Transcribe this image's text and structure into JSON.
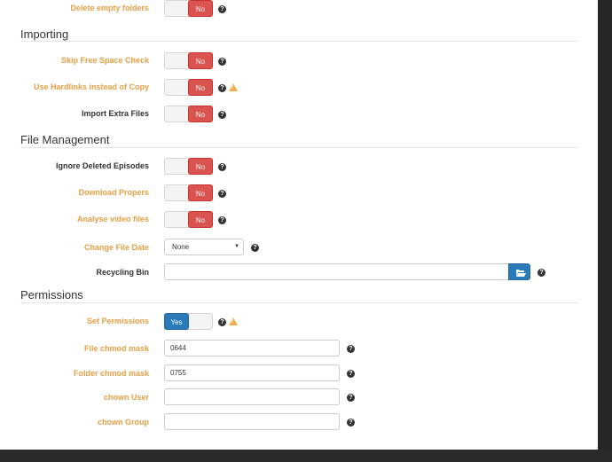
{
  "top_row": {
    "label": "Delete empty folders",
    "value": "No"
  },
  "sections": {
    "importing": "Importing",
    "file_management": "File Management",
    "permissions": "Permissions"
  },
  "importing": {
    "skip_free_space": {
      "label": "Skip Free Space Check",
      "value": "No"
    },
    "use_hardlinks": {
      "label": "Use Hardlinks instead of Copy",
      "value": "No"
    },
    "import_extra": {
      "label": "Import Extra Files",
      "value": "No"
    }
  },
  "file_management": {
    "ignore_deleted": {
      "label": "Ignore Deleted Episodes",
      "value": "No"
    },
    "download_propers": {
      "label": "Download Propers",
      "value": "No"
    },
    "analyse_video": {
      "label": "Analyse video files",
      "value": "No"
    },
    "change_file_date": {
      "label": "Change File Date",
      "value": "None"
    },
    "recycling_bin": {
      "label": "Recycling Bin",
      "value": ""
    }
  },
  "permissions": {
    "set_permissions": {
      "label": "Set Permissions",
      "value": "Yes"
    },
    "file_chmod": {
      "label": "File chmod mask",
      "value": "0644"
    },
    "folder_chmod": {
      "label": "Folder chmod mask",
      "value": "0755"
    },
    "chown_user": {
      "label": "chown User",
      "value": ""
    },
    "chown_group": {
      "label": "chown Group",
      "value": ""
    }
  },
  "icons": {
    "help": "question-circle-icon",
    "warning": "warning-triangle-icon",
    "folder": "folder-open-icon"
  },
  "colors": {
    "advanced_label": "#e59f45",
    "toggle_no": "#d9534f",
    "toggle_yes": "#2a7ab9"
  }
}
